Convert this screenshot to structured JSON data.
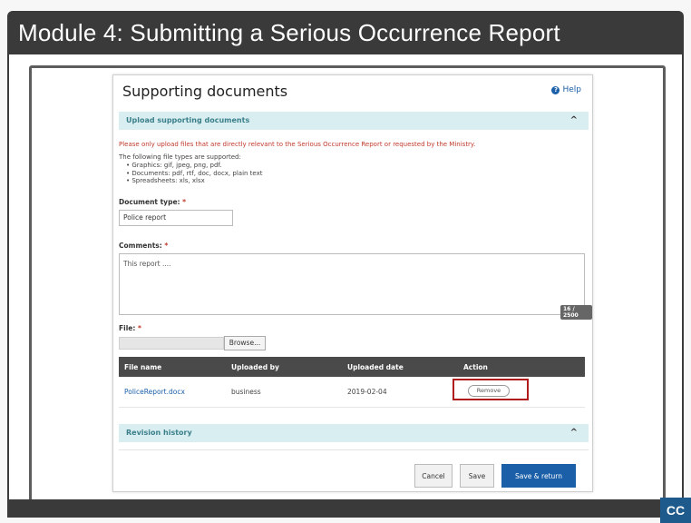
{
  "module": {
    "title": "Module 4:  Submitting a Serious Occurrence Report",
    "cc_label": "CC"
  },
  "app": {
    "title": "Supporting documents",
    "help_label": "Help",
    "upload_section": {
      "label": "Upload supporting documents",
      "chevron": "^"
    },
    "warning": "Please only upload files that are directly relevant to the Serious Occurrence Report or requested by the Ministry.",
    "types_intro": "The following file types are supported:",
    "types": [
      "Graphics: gif, jpeg, png, pdf.",
      "Documents: pdf, rtf, doc, docx, plain text",
      "Spreadsheets: xls, xlsx"
    ],
    "document_type": {
      "label": "Document type:",
      "required": "*",
      "value": "Police report"
    },
    "comments": {
      "label": "Comments:",
      "required": "*",
      "value": "This report ....",
      "char_count": "16 / 2500"
    },
    "file": {
      "label": "File:",
      "required": "*",
      "browse_label": "Browse..."
    },
    "files_table": {
      "headers": [
        "File name",
        "Uploaded by",
        "Uploaded date",
        "Action"
      ],
      "rows": [
        {
          "file_name": "PoliceReport.docx",
          "uploaded_by": "business",
          "uploaded_date": "2019-02-04",
          "action": "Remove"
        }
      ]
    },
    "revision_section": {
      "label": "Revision history",
      "chevron": "^"
    },
    "buttons": {
      "cancel": "Cancel",
      "save": "Save",
      "save_return": "Save & return"
    }
  },
  "colors": {
    "title_bar": "#3a3a3a",
    "section_bar": "#d9eef1",
    "primary": "#1a5fa8",
    "warning": "#c0392b",
    "highlight": "#b01c1c"
  }
}
